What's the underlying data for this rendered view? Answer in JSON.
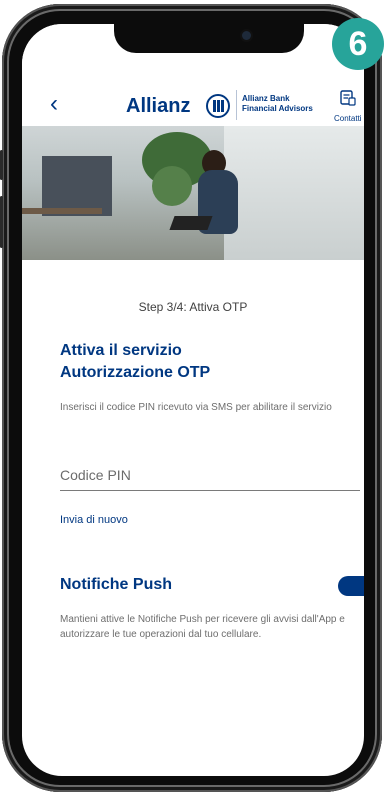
{
  "badge": "6",
  "header": {
    "back_icon": "chevron-left-icon",
    "brand": "Allianz",
    "brand_sub_line1": "Allianz Bank",
    "brand_sub_line2": "Financial Advisors",
    "contact_icon": "contact-card-icon",
    "contact_label": "Contatti"
  },
  "step": "Step 3/4: Attiva OTP",
  "title_line1": "Attiva il servizio",
  "title_line2": "Autorizzazione OTP",
  "description": "Inserisci il codice PIN ricevuto via SMS per abilitare il servizio",
  "pin_field": {
    "placeholder": "Codice PIN",
    "value": ""
  },
  "resend_label": "Invia di nuovo",
  "push": {
    "title": "Notifiche Push",
    "enabled": true,
    "description": "Mantieni attive le Notifiche Push per ricevere gli avvisi dall'App e autorizzare le tue operazioni dal tuo cellulare."
  },
  "colors": {
    "brand_blue": "#003781",
    "badge_teal": "#27a49a"
  }
}
